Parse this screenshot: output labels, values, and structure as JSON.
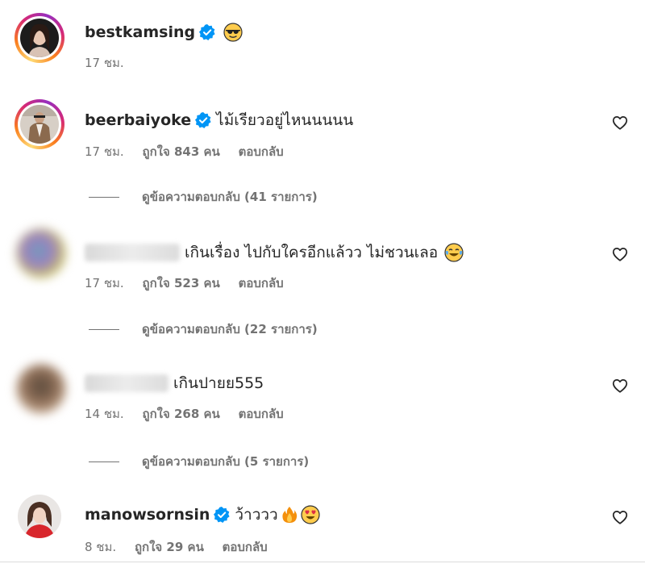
{
  "comments": [
    {
      "username": "bestkamsing",
      "text": "",
      "emoji": "sunglasses-emoji",
      "time": "17 ชม.",
      "likes": "",
      "reply_label": "",
      "view_replies": ""
    },
    {
      "username": "beerbaiyoke",
      "text": "ไม้เรียวอยู่ไหนนนนน",
      "time": "17 ชม.",
      "likes": "ถูกใจ 843 คน",
      "reply_label": "ตอบกลับ",
      "view_replies": "ดูข้อความตอบกลับ (41 รายการ)"
    },
    {
      "username": "",
      "text": "เกินเรื่อง ไปกับใครอีกแล้วว ไม่ชวนเลอ",
      "emoji": "tears-of-joy-emoji",
      "time": "17 ชม.",
      "likes": "ถูกใจ 523 คน",
      "reply_label": "ตอบกลับ",
      "view_replies": "ดูข้อความตอบกลับ (22 รายการ)"
    },
    {
      "username": "",
      "text": "เกินปายย555",
      "time": "14 ชม.",
      "likes": "ถูกใจ 268 คน",
      "reply_label": "ตอบกลับ",
      "view_replies": "ดูข้อความตอบกลับ (5 รายการ)"
    },
    {
      "username": "manowsornsin",
      "text": "ว้าววว",
      "emoji": "fire-and-heart-eyes-emoji",
      "time": "8 ชม.",
      "likes": "ถูกใจ 29 คน",
      "reply_label": "ตอบกลับ",
      "view_replies": ""
    }
  ],
  "colors": {
    "verified": "#0095f6",
    "meta": "#737373",
    "text": "#262626",
    "divider": "#dbdbdb"
  }
}
